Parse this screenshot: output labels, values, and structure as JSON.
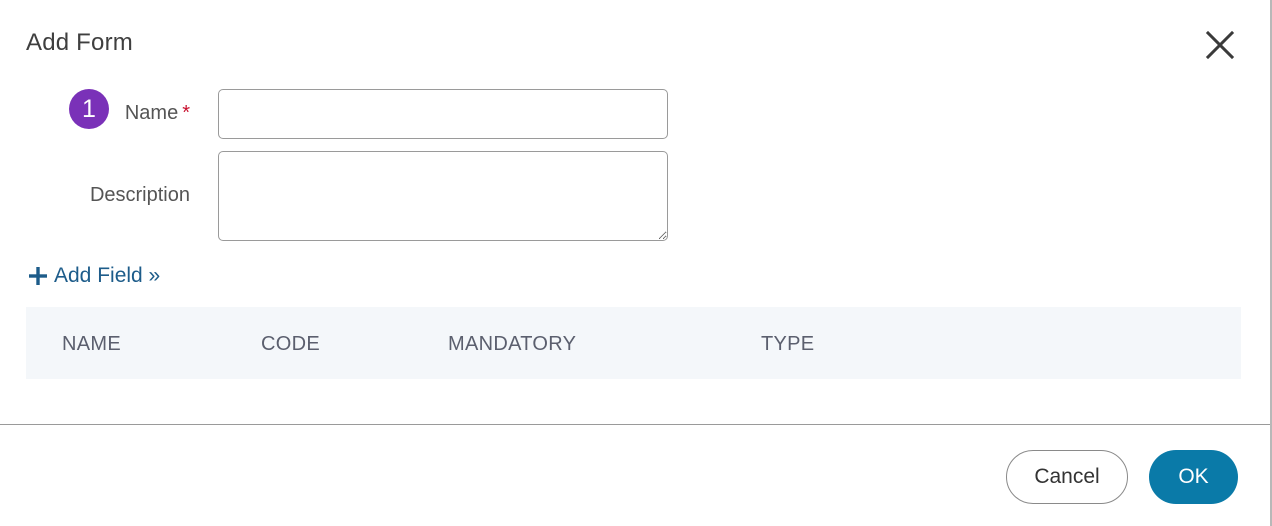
{
  "dialog": {
    "title": "Add Form",
    "close_icon": "close-icon"
  },
  "form": {
    "step_number": "1",
    "name_label": "Name",
    "required_marker": "*",
    "name_value": "",
    "description_label": "Description",
    "description_value": ""
  },
  "add_field": {
    "icon": "plus-icon",
    "label": "Add Field »"
  },
  "table": {
    "columns": [
      "NAME",
      "CODE",
      "MANDATORY",
      "TYPE"
    ],
    "rows": []
  },
  "footer": {
    "cancel_label": "Cancel",
    "ok_label": "OK"
  },
  "colors": {
    "step_badge": "#7a31b8",
    "required": "#c8102e",
    "link": "#1d5c8a",
    "primary_button": "#0a7aa8",
    "table_header_bg": "#f4f7fa"
  }
}
